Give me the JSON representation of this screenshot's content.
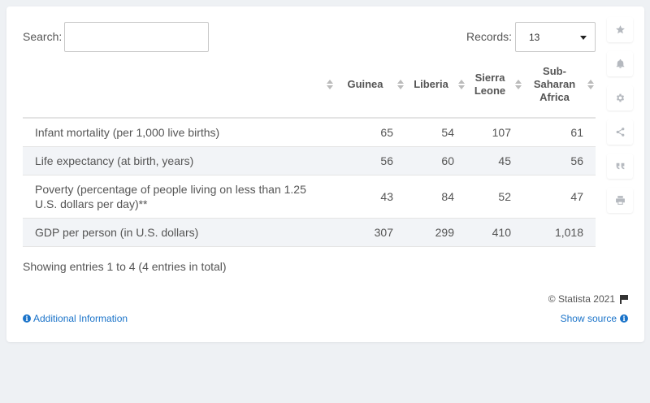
{
  "search": {
    "label": "Search:",
    "value": "",
    "placeholder": ""
  },
  "records": {
    "label": "Records:",
    "selected": "13"
  },
  "table": {
    "headers": [
      "",
      "Guinea",
      "Liberia",
      "Sierra Leone",
      "Sub-Saharan Africa"
    ],
    "rows": [
      {
        "label": "Infant mortality (per 1,000 live births)",
        "values": [
          "65",
          "54",
          "107",
          "61"
        ]
      },
      {
        "label": "Life expectancy (at birth, years)",
        "values": [
          "56",
          "60",
          "45",
          "56"
        ]
      },
      {
        "label": "Poverty (percentage of people living on less than 1.25 U.S. dollars per day)**",
        "values": [
          "43",
          "84",
          "52",
          "47"
        ]
      },
      {
        "label": "GDP per person (in U.S. dollars)",
        "values": [
          "307",
          "299",
          "410",
          "1,018"
        ]
      }
    ]
  },
  "footer": {
    "showing": "Showing entries 1 to 4 (4 entries in total)",
    "copyright": "© Statista 2021",
    "additional_info": "Additional Information",
    "show_source": "Show source"
  },
  "sidebar_icons": [
    "star-icon",
    "bell-icon",
    "gear-icon",
    "share-icon",
    "quote-icon",
    "print-icon"
  ]
}
